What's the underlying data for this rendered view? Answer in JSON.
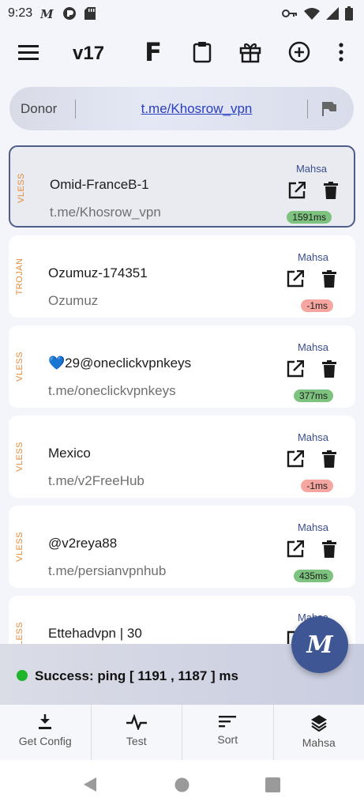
{
  "status_bar": {
    "time": "9:23",
    "left_icons": [
      "mahsa-app-icon",
      "circle-app-icon",
      "sd-card-icon"
    ],
    "right_icons": [
      "key-icon",
      "wifi-icon",
      "signal-icon",
      "battery-icon"
    ]
  },
  "toolbar": {
    "title": "v17",
    "f_label": "F",
    "icons": [
      "menu-icon",
      "clipboard-icon",
      "gift-icon",
      "add-circle-icon",
      "more-vert-icon"
    ]
  },
  "donor": {
    "label": "Donor",
    "link": "t.me/Khosrow_vpn"
  },
  "configs": [
    {
      "protocol": "VLESS",
      "name": "Omid-FranceB-1",
      "sub": "t.me/Khosrow_vpn",
      "type": "Mahsa",
      "ping": "1591ms",
      "ping_status": "good",
      "selected": true
    },
    {
      "protocol": "TROJAN",
      "name": "Ozumuz-174351",
      "sub": "Ozumuz",
      "type": "Mahsa",
      "ping": "-1ms",
      "ping_status": "bad",
      "selected": false
    },
    {
      "protocol": "VLESS",
      "name": "💙29@oneclickvpnkeys",
      "sub": "t.me/oneclickvpnkeys",
      "type": "Mahsa",
      "ping": "377ms",
      "ping_status": "good",
      "selected": false
    },
    {
      "protocol": "VLESS",
      "name": "Mexico",
      "sub": "t.me/v2FreeHub",
      "type": "Mahsa",
      "ping": "-1ms",
      "ping_status": "bad",
      "selected": false
    },
    {
      "protocol": "VLESS",
      "name": "@v2reya88",
      "sub": "t.me/persianvpnhub",
      "type": "Mahsa",
      "ping": "435ms",
      "ping_status": "good",
      "selected": false
    },
    {
      "protocol": "VLESS",
      "name": "Ettehadvpn | 30",
      "sub": "",
      "type": "Mahsa",
      "ping": "",
      "ping_status": "",
      "selected": false
    }
  ],
  "status": {
    "message": "Success: ping [ 1191 , 1187 ] ms",
    "color": "#1fb52a"
  },
  "fab": {
    "label": "M"
  },
  "bottom_nav": [
    {
      "label": "Get Config",
      "icon": "download-icon"
    },
    {
      "label": "Test",
      "icon": "pulse-icon"
    },
    {
      "label": "Sort",
      "icon": "sort-icon"
    },
    {
      "label": "Mahsa",
      "icon": "layers-icon"
    }
  ],
  "colors": {
    "accent": "#3f5694",
    "protocol": "#e38b3b",
    "ping_good": "#7ec27f",
    "ping_bad": "#f5a6a0",
    "link": "#2a3ec0"
  }
}
